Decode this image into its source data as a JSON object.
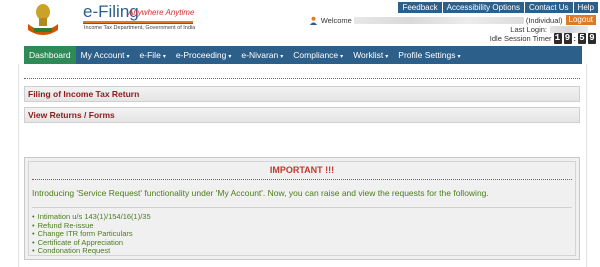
{
  "header": {
    "app_title": "e-Filing",
    "tagline": "Anywhere Anytime",
    "subtitle": "Income Tax Department, Government of India"
  },
  "topnav": {
    "items": [
      "Feedback",
      "Accessibility Options",
      "Contact Us",
      "Help"
    ]
  },
  "user": {
    "welcome": "Welcome",
    "role": "(Individual)",
    "logout_label": "Logout",
    "last_login_label": "Last Login:",
    "timer_label": "Idle Session Timer",
    "timer_digits": [
      "1",
      "9",
      "5",
      "9"
    ]
  },
  "mainnav": {
    "items": [
      {
        "label": "Dashboard",
        "active": true,
        "caret": ""
      },
      {
        "label": "My Account",
        "active": false,
        "caret": "▾"
      },
      {
        "label": "e-File",
        "active": false,
        "caret": "▾"
      },
      {
        "label": "e-Proceeding",
        "active": false,
        "caret": "▾"
      },
      {
        "label": "e-Nivaran",
        "active": false,
        "caret": "▾"
      },
      {
        "label": "Compliance",
        "active": false,
        "caret": "▾"
      },
      {
        "label": "Worklist",
        "active": false,
        "caret": "▾"
      },
      {
        "label": "Profile Settings",
        "active": false,
        "caret": "▾"
      }
    ]
  },
  "panels": {
    "filing": "Filing of Income Tax Return",
    "view": "View Returns / Forms"
  },
  "notice": {
    "heading": "IMPORTANT !!!",
    "intro": "Introducing 'Service Request' functionality under 'My Account'. Now, you can raise and view the requests for the following.",
    "items": [
      "Intimation u/s 143(1)/154/16(1)/35",
      "Refund Re-issue",
      "Change ITR form Particulars",
      "Certificate of Appreciation",
      "Condonation Request"
    ]
  },
  "colors": {
    "nav_blue": "#2d5f8b",
    "active_green": "#2e8b57",
    "logout_orange": "#e07a22",
    "important_red": "#c0392b",
    "text_green": "#4b7d1a"
  }
}
